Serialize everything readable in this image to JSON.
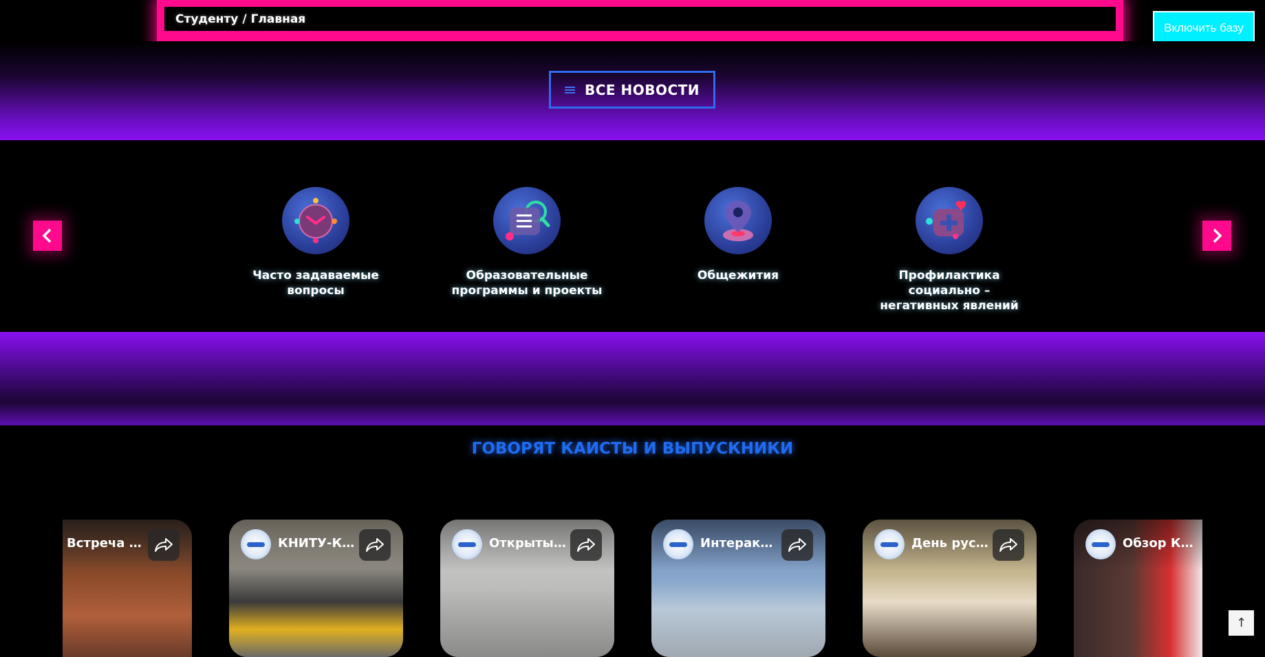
{
  "breadcrumb": {
    "parent": "Студенту",
    "separator": "/",
    "current": "Главная"
  },
  "base_button": "Включить базу",
  "news_button": {
    "label": "ВСЕ НОВОСТИ",
    "icon": "list-icon"
  },
  "carousel": {
    "items": [
      {
        "label_line1": "Часто задаваемые вопросы",
        "label_line2": "",
        "icon": "clock-icon"
      },
      {
        "label_line1": "Образовательные",
        "label_line2": "программы и проекты",
        "icon": "document-search-icon"
      },
      {
        "label_line1": "Общежития",
        "label_line2": "",
        "icon": "location-pin-icon"
      },
      {
        "label_line1": "Профилактика социально –",
        "label_line2": "негативных явлений",
        "icon": "medical-cross-icon"
      }
    ]
  },
  "reviews": {
    "title": "ГОВОРЯТ КАИСТЫ И ВЫПУСКНИКИ",
    "videos": [
      {
        "title": "Встреча и.о..."
      },
      {
        "title": "КНИТУ-КАИ ..."
      },
      {
        "title": "Открытый ..."
      },
      {
        "title": "Интерактив..."
      },
      {
        "title": "День русско..."
      },
      {
        "title": "Обзор КАИ"
      }
    ]
  },
  "scroll_top": "↑",
  "colors": {
    "accent_pink": "#ff0a8c",
    "accent_blue": "#1f6cf0",
    "accent_cyan": "#00f0ff",
    "accent_purple": "#8a10f0"
  }
}
